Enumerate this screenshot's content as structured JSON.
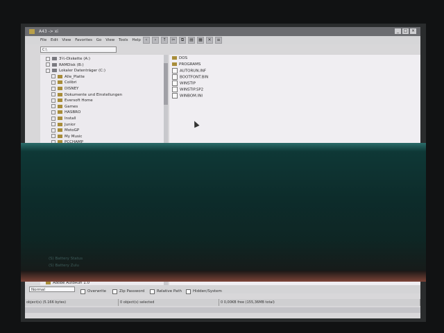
{
  "window": {
    "title": "A43 -> xi"
  },
  "menu": [
    "File",
    "Edit",
    "View",
    "Favorites",
    "Go",
    "View",
    "Tools",
    "Help"
  ],
  "path_value": "C:\\",
  "tree": [
    {
      "label": "3½-Diskette (A:)",
      "type": "drive",
      "indent": 0
    },
    {
      "label": "RAMDisk (B:)",
      "type": "drive",
      "indent": 0
    },
    {
      "label": "Lokaler Datenträger (C:)",
      "type": "drive",
      "indent": 0
    },
    {
      "label": "Alle_Platte",
      "type": "folder",
      "indent": 1
    },
    {
      "label": "Colibri",
      "type": "folder",
      "indent": 1
    },
    {
      "label": "DISNEY",
      "type": "folder",
      "indent": 1
    },
    {
      "label": "Dokumente und Einstellungen",
      "type": "folder",
      "indent": 1
    },
    {
      "label": "Eversoft Home",
      "type": "folder",
      "indent": 1
    },
    {
      "label": "Games",
      "type": "folder",
      "indent": 1
    },
    {
      "label": "HASBRO",
      "type": "folder",
      "indent": 1
    },
    {
      "label": "Install",
      "type": "folder",
      "indent": 1
    },
    {
      "label": "Junior",
      "type": "folder",
      "indent": 1
    },
    {
      "label": "MotoGP",
      "type": "folder",
      "indent": 1
    },
    {
      "label": "My Music",
      "type": "folder",
      "indent": 1
    },
    {
      "label": "PCCHAMP",
      "type": "folder",
      "indent": 1
    }
  ],
  "tree_bottom": [
    {
      "label": "Acoustica 4",
      "type": "folder",
      "indent": 1
    },
    {
      "label": "Adobe AutoRun 1.0",
      "type": "folder",
      "indent": 0
    }
  ],
  "ghost_items": [
    "(S) Battery Status",
    "(S) Battery Zulu"
  ],
  "files": [
    {
      "label": "DOS",
      "type": "folder"
    },
    {
      "label": "PROGRAMS",
      "type": "folder"
    },
    {
      "label": "AUTORUN.INF",
      "type": "file"
    },
    {
      "label": "BOOTFONT.BIN",
      "type": "file"
    },
    {
      "label": "WINSTIP",
      "type": "file"
    },
    {
      "label": "WINSTIP.SP2",
      "type": "file"
    },
    {
      "label": "WINBOM.INI",
      "type": "file"
    }
  ],
  "options": {
    "select_value": "Normal",
    "overwrite": "Overwrite",
    "zip_password": "Zip Password",
    "relative_path": "Relative Path",
    "hidden_system": "Hidden/System"
  },
  "status": {
    "left": "object(s) (5.166 bytes)",
    "middle": "0 object(s) selected",
    "right": "0 0,00KB free (155,36MB total)"
  },
  "colors": {
    "band": "#0f3a38",
    "window": "#d8d7d9",
    "folder": "#a88d3a"
  }
}
